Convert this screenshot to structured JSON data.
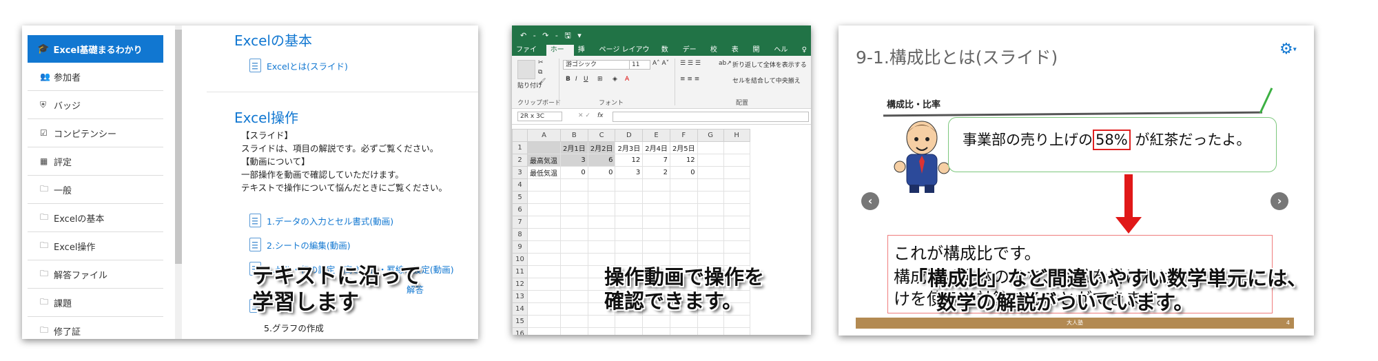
{
  "lms": {
    "course_title": "Excel基礎まるわかり",
    "nav": [
      {
        "icon": "users-icon",
        "glyph": "👥",
        "label": "参加者"
      },
      {
        "icon": "shield-icon",
        "glyph": "⛨",
        "label": "バッジ"
      },
      {
        "icon": "checkbox-icon",
        "glyph": "☑",
        "label": "コンピテンシー"
      },
      {
        "icon": "grid-icon",
        "glyph": "▦",
        "label": "評定"
      },
      {
        "icon": "folder-icon",
        "glyph": "🗀",
        "label": "一般"
      },
      {
        "icon": "folder-icon",
        "glyph": "🗀",
        "label": "Excelの基本"
      },
      {
        "icon": "folder-icon",
        "glyph": "🗀",
        "label": "Excel操作"
      },
      {
        "icon": "folder-icon",
        "glyph": "🗀",
        "label": "解答ファイル"
      },
      {
        "icon": "folder-icon",
        "glyph": "🗀",
        "label": "課題"
      },
      {
        "icon": "folder-icon",
        "glyph": "🗀",
        "label": "修了証"
      }
    ],
    "section1": {
      "title": "Excelの基本",
      "link": "Excelとは(スライド)"
    },
    "section2": {
      "title": "Excel操作",
      "lines": [
        "【スライド】",
        "スライドは、項目の解説です。必ずご覧ください。",
        "【動画について】",
        "一部操作を動画で確認していただけます。",
        "テキストで操作について悩んだときにご覧ください。"
      ],
      "links": [
        "1.データの入力とセル書式(動画)",
        "2.シートの編集(動画)",
        "3.セル・行の設定・高さ調整・罫線の設定(動画)",
        "解答"
      ],
      "item5": "5.グラフの作成"
    },
    "caption": [
      "テキストに沿って",
      "学習します"
    ]
  },
  "excel": {
    "qat": "↶ - ↷ - 🖫 ▾",
    "tabs": [
      "ファイル",
      "ホーム",
      "挿入",
      "ページ レイアウト",
      "数式",
      "データ",
      "校閲",
      "表示",
      "開発",
      "ヘルプ",
      "♀"
    ],
    "active_tab": "ホーム",
    "paste_label": "貼り付け",
    "font_name": "游ゴシック",
    "font_size": "11",
    "wrap_text": "折り返して全体を表示する",
    "merge_center": "セルを結合して中央揃え",
    "group_clipboard": "クリップボード",
    "group_font": "フォント",
    "group_align": "配置",
    "name_box": "2R x 3C",
    "fx": "fx",
    "columns": [
      "A",
      "B",
      "C",
      "D",
      "E",
      "F",
      "G",
      "H"
    ],
    "rows": [
      [
        "",
        "2月1日",
        "2月2日",
        "2月3日",
        "2月4日",
        "2月5日",
        "",
        ""
      ],
      [
        "最高気温",
        "3",
        "6",
        "12",
        "7",
        "12",
        "",
        ""
      ],
      [
        "最低気温",
        "0",
        "0",
        "3",
        "2",
        "0",
        "",
        ""
      ]
    ],
    "row_count": 16,
    "caption": [
      "操作動画で操作を",
      "確認できます。"
    ]
  },
  "slide": {
    "title": "9-1.構成比とは(スライド)",
    "heading": "構成比・比率",
    "bubble_pre": "事業部の売り上げの",
    "bubble_hl": "58%",
    "bubble_post": "が紅茶だったよ。",
    "line1": "これが構成比です。",
    "line2": "構成比は全体のうち、比較を掛ければ",
    "line3": "けを使うと計算することができます。",
    "footer": "大人塾",
    "page": "4",
    "caption": [
      "「構成比」など間違いやすい数学単元には、",
      "数学の解説がついています。"
    ]
  }
}
